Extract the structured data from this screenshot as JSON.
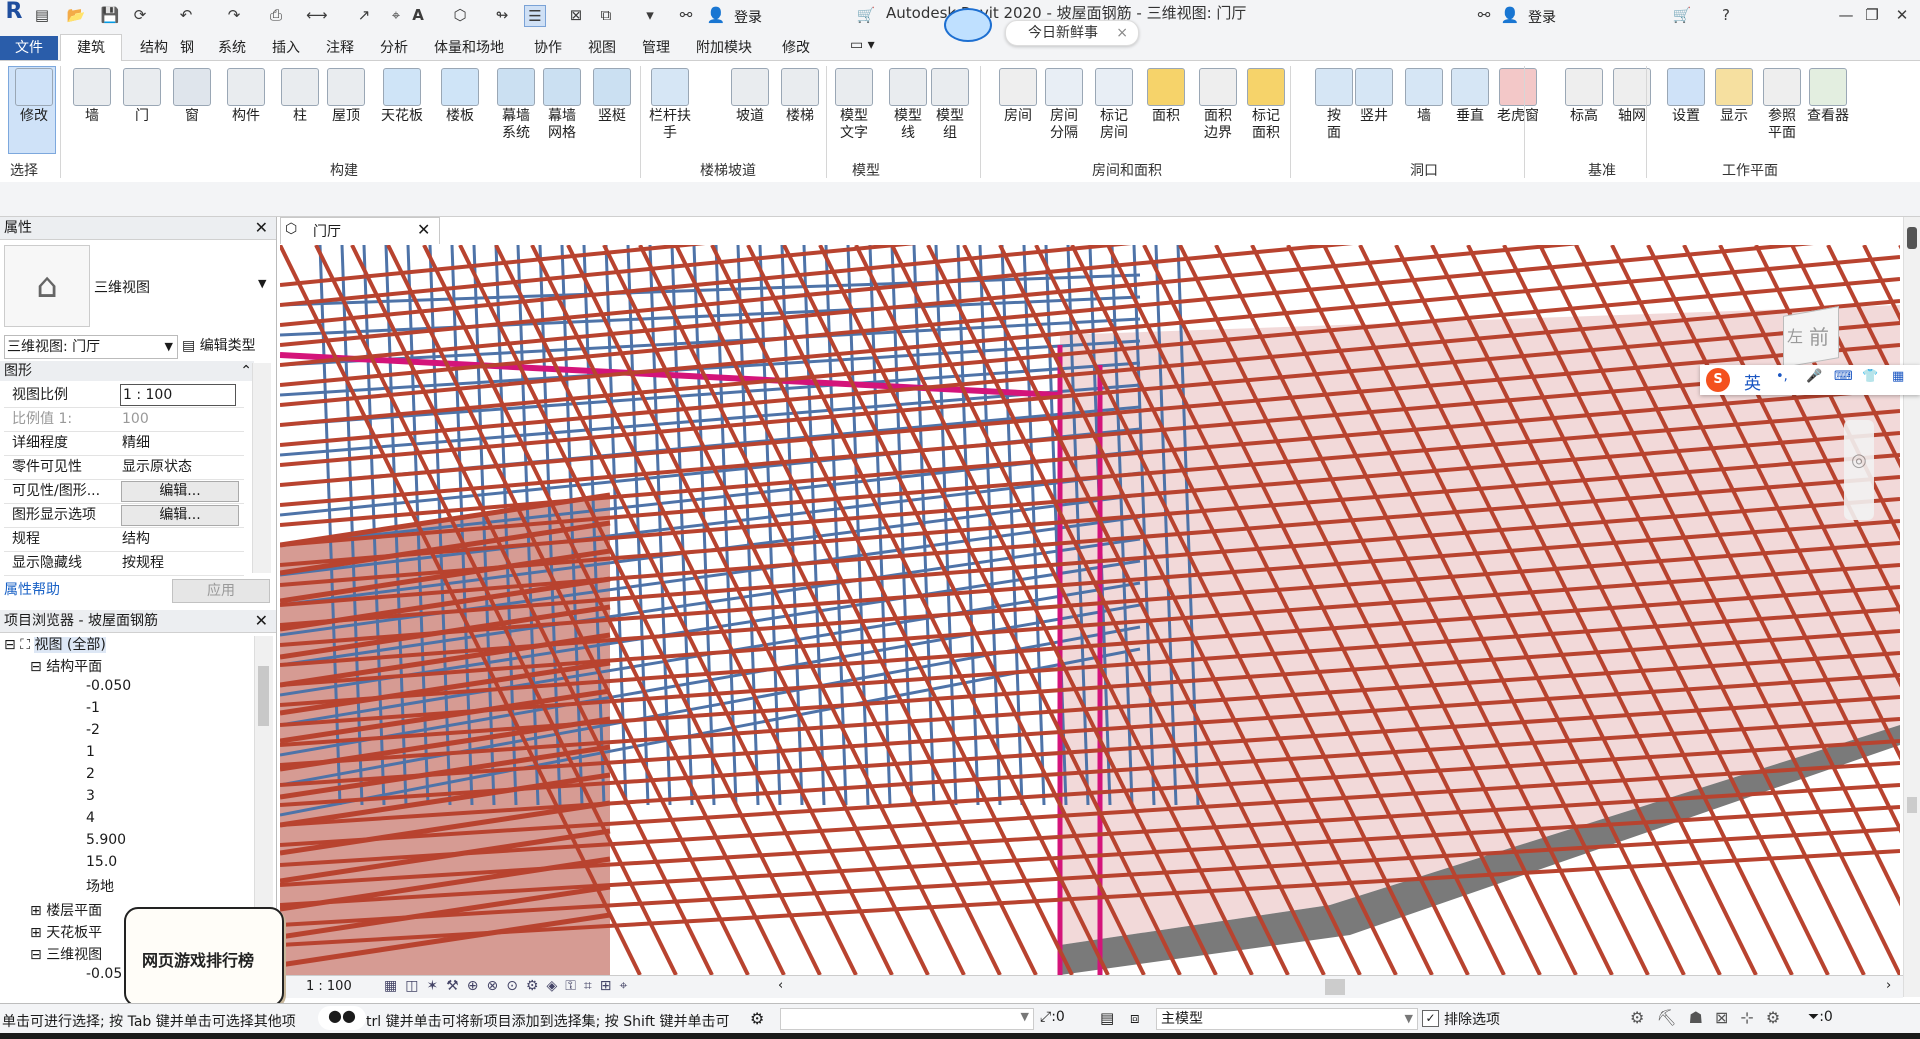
{
  "titlebar": {
    "title": "Autodesk Revit 2020 -  坡屋面钢筋 - 三维视图: 门厅",
    "login_left": "登录",
    "login_right": "登录",
    "news": "今日新鲜事"
  },
  "menu": {
    "file": "文件",
    "tabs": [
      "建筑",
      "结构",
      "钢",
      "系统",
      "插入",
      "注释",
      "分析",
      "体量和场地",
      "协作",
      "视图",
      "管理",
      "附加模块",
      "修改"
    ]
  },
  "ribbon": {
    "buttons": [
      {
        "label": "修改",
        "icon": "cursor-icon"
      },
      {
        "label": "墙",
        "icon": "wall-icon"
      },
      {
        "label": "门",
        "icon": "door-icon"
      },
      {
        "label": "窗",
        "icon": "window-icon"
      },
      {
        "label": "构件",
        "icon": "component-icon"
      },
      {
        "label": "柱",
        "icon": "column-icon"
      },
      {
        "label": "屋顶",
        "icon": "roof-icon"
      },
      {
        "label": "天花板",
        "icon": "ceiling-icon"
      },
      {
        "label": "楼板",
        "icon": "floor-icon"
      },
      {
        "label": "幕墙\n系统",
        "icon": "curtain-system-icon"
      },
      {
        "label": "幕墙\n网格",
        "icon": "curtain-grid-icon"
      },
      {
        "label": "竖梃",
        "icon": "mullion-icon"
      },
      {
        "label": "栏杆扶手",
        "icon": "railing-icon"
      },
      {
        "label": "坡道",
        "icon": "ramp-icon"
      },
      {
        "label": "楼梯",
        "icon": "stair-icon"
      },
      {
        "label": "模型\n文字",
        "icon": "model-text-icon"
      },
      {
        "label": "模型\n线",
        "icon": "model-line-icon"
      },
      {
        "label": "模型\n组",
        "icon": "model-group-icon"
      },
      {
        "label": "房间",
        "icon": "room-icon"
      },
      {
        "label": "房间\n分隔",
        "icon": "room-separator-icon"
      },
      {
        "label": "标记\n房间",
        "icon": "tag-room-icon"
      },
      {
        "label": "面积",
        "icon": "area-icon"
      },
      {
        "label": "面积\n边界",
        "icon": "area-boundary-icon"
      },
      {
        "label": "标记\n面积",
        "icon": "tag-area-icon"
      },
      {
        "label": "按\n面",
        "icon": "by-face-icon"
      },
      {
        "label": "竖井",
        "icon": "shaft-icon"
      },
      {
        "label": "墙",
        "icon": "wall-opening-icon"
      },
      {
        "label": "垂直",
        "icon": "vertical-icon"
      },
      {
        "label": "老虎窗",
        "icon": "dormer-icon"
      },
      {
        "label": "标高",
        "icon": "level-icon"
      },
      {
        "label": "轴网",
        "icon": "grid-icon"
      },
      {
        "label": "设置",
        "icon": "set-icon"
      },
      {
        "label": "显示",
        "icon": "show-icon"
      },
      {
        "label": "参照\n平面",
        "icon": "ref-plane-icon"
      },
      {
        "label": "查看器",
        "icon": "viewer-icon"
      }
    ],
    "groups": [
      "选择",
      "构建",
      "楼梯坡道",
      "模型",
      "房间和面积",
      "洞口",
      "基准",
      "工作平面"
    ]
  },
  "properties": {
    "title": "属性",
    "type_name": "三维视图",
    "view_selector": "三维视图: 门厅",
    "edit_type": "编辑类型",
    "section": "图形",
    "rows": [
      {
        "name": "视图比例",
        "value": "1 : 100"
      },
      {
        "name": "比例值 1:",
        "value": "100"
      },
      {
        "name": "详细程度",
        "value": "精细"
      },
      {
        "name": "零件可见性",
        "value": "显示原状态"
      },
      {
        "name": "可见性/图形...",
        "value": "编辑..."
      },
      {
        "name": "图形显示选项",
        "value": "编辑..."
      },
      {
        "name": "规程",
        "value": "结构"
      },
      {
        "name": "显示隐藏线",
        "value": "按规程"
      }
    ],
    "help": "属性帮助",
    "apply": "应用"
  },
  "browser": {
    "title": "项目浏览器 - 坡屋面钢筋",
    "root": "视图 (全部)",
    "struct_plans": "结构平面",
    "levels": [
      "-0.050",
      "-1",
      "-2",
      "1",
      "2",
      "3",
      "4",
      "5.900",
      "15.0",
      "场地"
    ],
    "floor_plans": "楼层平面",
    "ceiling_plans": "天花板平",
    "views_3d": "三维视图",
    "last_item": "-0.05"
  },
  "view": {
    "tab": "门厅",
    "scale": "1 : 100",
    "navcube_face": "前",
    "navcube_side": "左"
  },
  "statusbar": {
    "hint": "单击可进行选择; 按 Tab 键并单击可选择其他项",
    "hint2": "trl 键并单击可将新项目添加到选择集; 按 Shift 键并单击可",
    "count": ":0",
    "model": "主模型",
    "exclude": "排除选项",
    "filter_count": ":0"
  },
  "ime": {
    "label": "英"
  },
  "ad": {
    "text": "网页游戏排行榜"
  },
  "colors": {
    "accent": "#2a5daa",
    "rebar_red": "#b8432f",
    "rebar_blue": "#4e73a8",
    "rebar_magenta": "#d4147a"
  }
}
